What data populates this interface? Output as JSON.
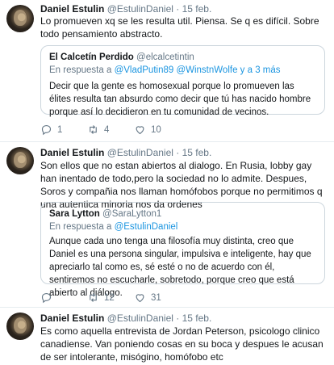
{
  "tweets": [
    {
      "name": "Daniel Estulin",
      "handle": "@EstulinDaniel",
      "date": "15 feb.",
      "text": "Lo promueven xq se les resulta util. Piensa. Se q es difícil. Sobre todo pensamiento abstracto.",
      "quote": {
        "name": "El Calcetín Perdido",
        "handle": "@elcalcetintin",
        "reply_prefix": "En respuesta a",
        "reply_links": "@VladPutin89 @WinstnWolfe y a 3 más",
        "text": "Decir que la gente es homosexual porque lo promueven las élites resulta tan absurdo como decir que tú has nacido hombre porque así lo decidieron en tu comunidad de vecinos."
      },
      "replies": "1",
      "retweets": "4",
      "likes": "10"
    },
    {
      "name": "Daniel Estulin",
      "handle": "@EstulinDaniel",
      "date": "15 feb.",
      "text": "Son ellos que no estan abiertos al dialogo. En Rusia, lobby gay han inentado de todo,pero la sociedad no lo admite. Despues, Soros y compañia nos llaman homófobos porque no permitimos q una autentica minoria nos da ordenes",
      "quote": {
        "name": "Sara Lytton",
        "handle": "@SaraLytton1",
        "reply_prefix": "En respuesta a",
        "reply_links": "@EstulinDaniel",
        "text": "Aunque cada uno tenga una filosofía muy distinta, creo que  Daniel es una persona singular, impulsiva e inteligente, hay que apreciarlo tal como es, sé esté o no de acuerdo con él, sentiremos no escucharle, sobretodo, porque creo que está abierto al diálogo."
      },
      "replies": "",
      "retweets": "12",
      "likes": "31"
    },
    {
      "name": "Daniel Estulin",
      "handle": "@EstulinDaniel",
      "date": "15 feb.",
      "text": "Es como aquella  entrevista de Jordan Peterson, psicologo clinico canadiense. Van poniendo cosas en su boca y despues le acusan de ser intolerante, misógino, homófobo etc"
    }
  ],
  "icons": {
    "reply": "reply-icon",
    "retweet": "retweet-icon",
    "like": "heart-icon"
  },
  "colors": {
    "link": "#1b95e0",
    "muted": "#657786",
    "border": "#e6ecf0"
  }
}
